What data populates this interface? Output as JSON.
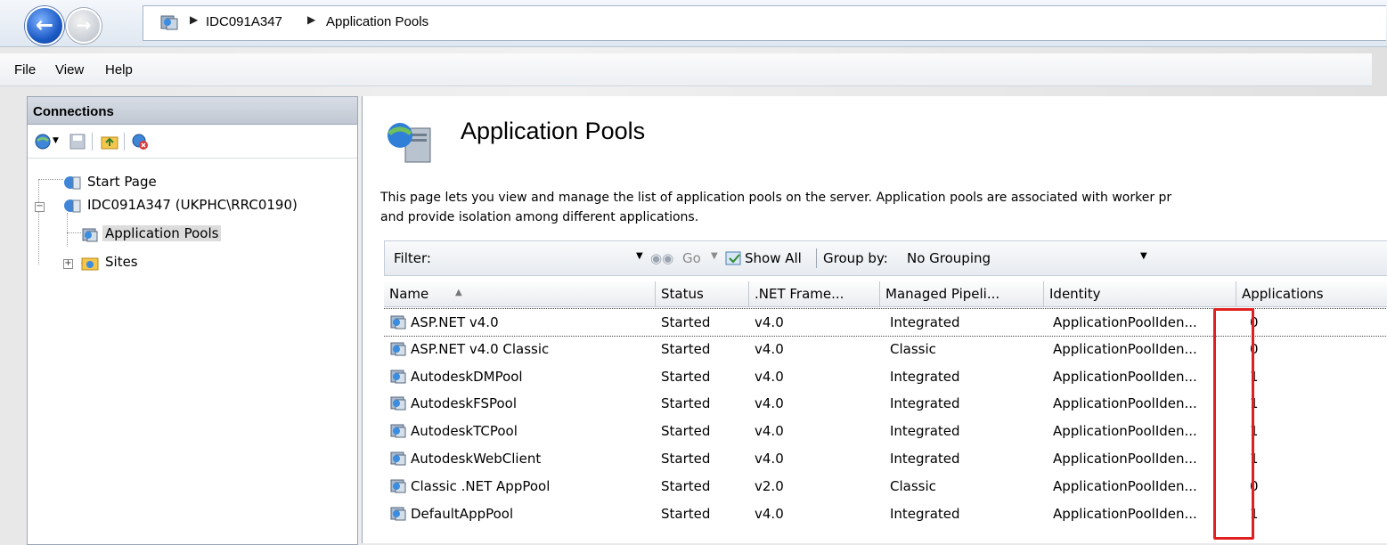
{
  "breadcrumb": {
    "server": "IDC091A347",
    "page": "Application Pools"
  },
  "menu": [
    "File",
    "View",
    "Help"
  ],
  "connections": {
    "title": "Connections",
    "tree": [
      {
        "label": "Start Page",
        "level": 1
      },
      {
        "label": "IDC091A347 (UKPHC\\RRC0190)",
        "level": 1,
        "expanded": true
      },
      {
        "label": "Application Pools",
        "level": 2,
        "selected": true
      },
      {
        "label": "Sites",
        "level": 2,
        "collapsed": true
      }
    ]
  },
  "main": {
    "title": "Application Pools",
    "description": "This page lets you view and manage the list of application pools on the server. Application pools are associated with worker pr",
    "description2": "and provide isolation among different applications.",
    "filter": {
      "label": "Filter:",
      "value": "",
      "go": "Go",
      "show_all": "Show All",
      "group_by": "Group by:",
      "group_value": "No Grouping"
    },
    "columns": [
      "Name",
      "Status",
      ".NET Frame...",
      "Managed Pipeli...",
      "Identity",
      "Applications"
    ],
    "rows": [
      [
        "ASP.NET v4.0",
        "Started",
        "v4.0",
        "Integrated",
        "ApplicationPoolIden...",
        "0"
      ],
      [
        "ASP.NET v4.0 Classic",
        "Started",
        "v4.0",
        "Classic",
        "ApplicationPoolIden...",
        "0"
      ],
      [
        "AutodeskDMPool",
        "Started",
        "v4.0",
        "Integrated",
        "ApplicationPoolIden...",
        "1"
      ],
      [
        "AutodeskFSPool",
        "Started",
        "v4.0",
        "Integrated",
        "ApplicationPoolIden...",
        "1"
      ],
      [
        "AutodeskTCPool",
        "Started",
        "v4.0",
        "Integrated",
        "ApplicationPoolIden...",
        "1"
      ],
      [
        "AutodeskWebClient",
        "Started",
        "v4.0",
        "Integrated",
        "ApplicationPoolIden...",
        "1"
      ],
      [
        "Classic .NET AppPool",
        "Started",
        "v2.0",
        "Classic",
        "ApplicationPoolIden...",
        "0"
      ],
      [
        "DefaultAppPool",
        "Started",
        "v4.0",
        "Integrated",
        "ApplicationPoolIden...",
        "1"
      ]
    ]
  },
  "highlight_color": "#e02020"
}
